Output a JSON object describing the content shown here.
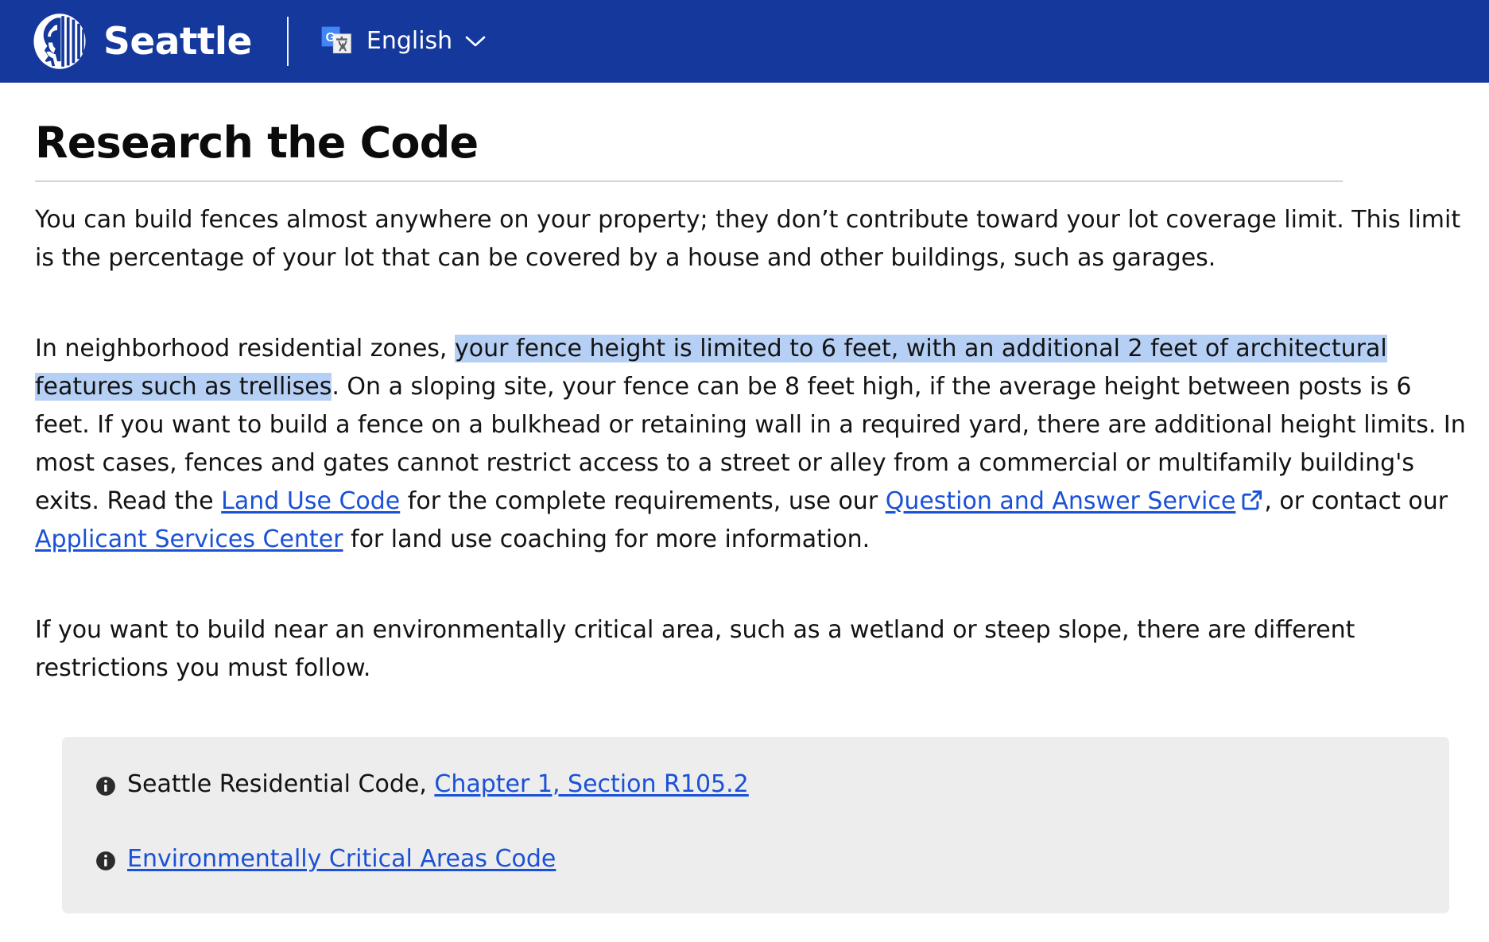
{
  "header": {
    "logo_alt": "City of Seattle seal",
    "brand": "Seattle",
    "language": {
      "icon": "google-translate-icon",
      "label": "English",
      "chevron": "chevron-down-icon"
    }
  },
  "main": {
    "title": "Research the Code",
    "paragraphs": [
      {
        "id": "p1",
        "segments": [
          {
            "type": "text",
            "value": "You can build fences almost anywhere on your property; they don’t contribute toward your lot coverage limit. This limit is the percentage of your lot that can be covered by a house and other buildings, such as garages."
          }
        ]
      },
      {
        "id": "p2",
        "segments": [
          {
            "type": "text",
            "value": "In neighborhood residential zones, "
          },
          {
            "type": "highlight",
            "value": "your fence height is limited to 6 feet, with an additional 2 feet of architectural features such as trellises"
          },
          {
            "type": "text",
            "value": ". On a sloping site, your fence can be 8 feet high, if the average height between posts is 6 feet. If you want to build a fence on a bulkhead or retaining wall in a required yard, there are additional height limits. In most cases, fences and gates cannot restrict access to a street or alley from a commercial or multifamily building's exits. Read the "
          },
          {
            "type": "link",
            "value": "Land Use Code"
          },
          {
            "type": "text",
            "value": " for the complete requirements, use our "
          },
          {
            "type": "link",
            "value": "Question and Answer Service",
            "external": true
          },
          {
            "type": "text",
            "value": ", or contact our "
          },
          {
            "type": "link",
            "value": "Applicant Services Center"
          },
          {
            "type": "text",
            "value": " for land use coaching for more information."
          }
        ]
      },
      {
        "id": "p3",
        "segments": [
          {
            "type": "text",
            "value": "If you want to build near an environmentally critical area, such as a wetland or steep slope, there are different restrictions you must follow."
          }
        ]
      }
    ],
    "paragraph_1_text": "You can build fences almost anywhere on your property; they don’t contribute toward your lot coverage limit. This limit is the percentage of your lot that can be covered by a house and other buildings, such as garages.",
    "paragraph_3_text": "If you want to build near an environmentally critical area, such as a wetland or steep slope, there are different restrictions you must follow.",
    "p2_lead": "In neighborhood residential zones, ",
    "p2_highlight": "your fence height is limited to 6 feet, with an additional 2 feet of architectural features such as trellises",
    "p2_mid": ". On a sloping site, your fence can be 8 feet high, if the average height between posts is 6 feet. If you want to build a fence on a bulkhead or retaining wall in a required yard, there are additional height limits. In most cases, fences and gates cannot restrict access to a street or alley from a commercial or multifamily building's exits. Read the ",
    "link_land_use_code": "Land Use Code",
    "p2_after_luc": " for the complete requirements, use our ",
    "link_qa_service": "Question and Answer Service",
    "p2_after_qa": ", or contact our ",
    "link_asc": "Applicant Services Center",
    "p2_tail": " for land use coaching for more information."
  },
  "callout": {
    "rows": [
      {
        "icon": "info-icon",
        "prefix": "Seattle Residential Code, ",
        "link": "Chapter 1, Section R105.2"
      },
      {
        "icon": "info-icon",
        "prefix": "",
        "link": "Environmentally Critical Areas Code"
      }
    ]
  },
  "colors": {
    "header_blue": "#15389C",
    "link_blue": "#1a51d6",
    "highlight_blue": "#b6d0f5",
    "callout_gray": "#ededed",
    "rule_gray": "#d2d4d8",
    "text_black": "#131313"
  }
}
